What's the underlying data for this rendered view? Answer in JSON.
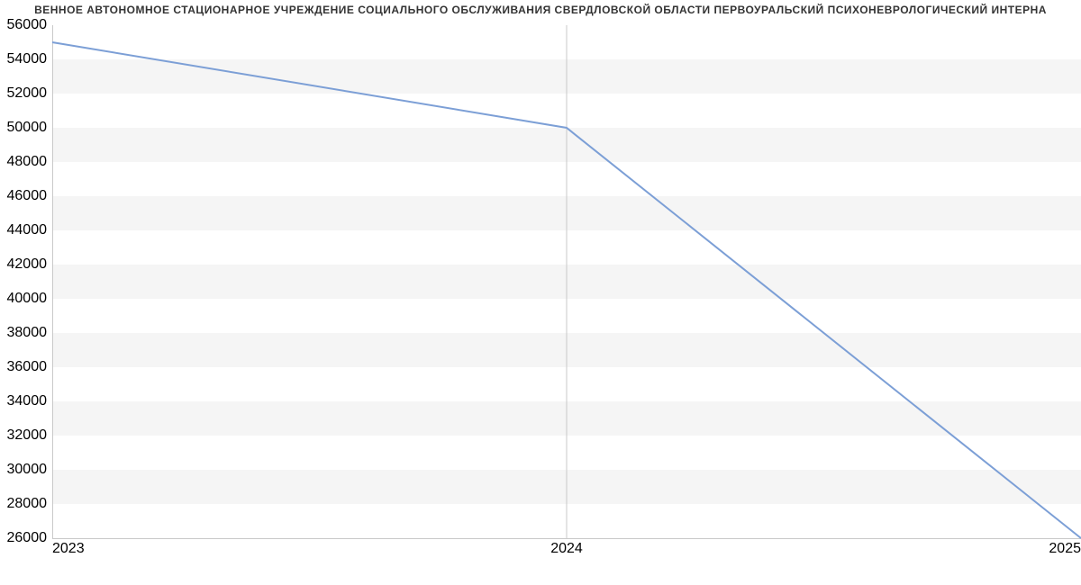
{
  "chart_data": {
    "type": "line",
    "title": "ВЕННОЕ АВТОНОМНОЕ СТАЦИОНАРНОЕ УЧРЕЖДЕНИЕ СОЦИАЛЬНОГО ОБСЛУЖИВАНИЯ СВЕРДЛОВСКОЙ ОБЛАСТИ ПЕРВОУРАЛЬСКИЙ ПСИХОНЕВРОЛОГИЧЕСКИЙ ИНТЕРНА",
    "x": [
      2023,
      2024,
      2025
    ],
    "values": [
      55000,
      50000,
      26000
    ],
    "xticks": [
      2023,
      2024,
      2025
    ],
    "yticks": [
      26000,
      28000,
      30000,
      32000,
      34000,
      36000,
      38000,
      40000,
      42000,
      44000,
      46000,
      48000,
      50000,
      52000,
      54000,
      56000
    ],
    "xlim": [
      2023,
      2025
    ],
    "ylim": [
      26000,
      56000
    ],
    "xlabel": "",
    "ylabel": ""
  }
}
